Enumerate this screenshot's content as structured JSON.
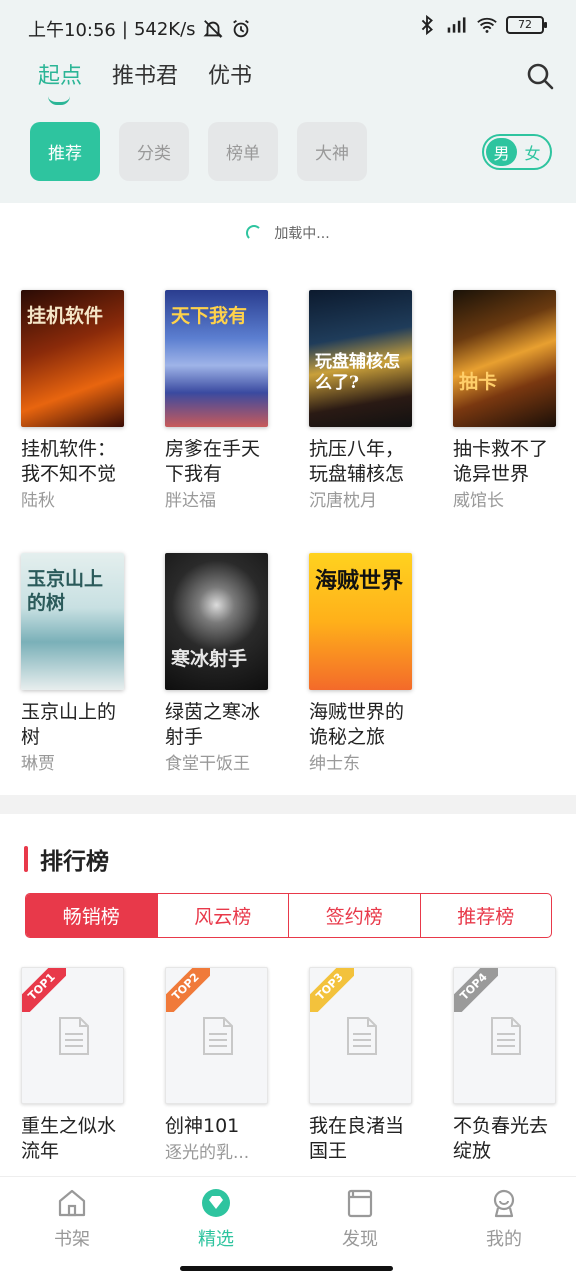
{
  "status_bar": {
    "time": "上午10:56",
    "separator": "|",
    "net_speed": "542K/s",
    "battery": "72",
    "icons": [
      "mute-bell-icon",
      "alarm-icon",
      "bluetooth-icon",
      "signal-hd-icon",
      "wifi-icon",
      "battery-icon"
    ]
  },
  "top_tabs": [
    {
      "label": "起点",
      "active": true
    },
    {
      "label": "推书君",
      "active": false
    },
    {
      "label": "优书",
      "active": false
    }
  ],
  "chips": [
    {
      "label": "推荐",
      "active": true
    },
    {
      "label": "分类",
      "active": false
    },
    {
      "label": "榜单",
      "active": false
    },
    {
      "label": "大神",
      "active": false
    }
  ],
  "gender": {
    "male": "男",
    "female": "女",
    "selected": "男"
  },
  "loading_text": "加载中...",
  "books": [
    {
      "title": "挂机软件：我不知不觉",
      "author": "陆秋",
      "cover_text": "挂机软件"
    },
    {
      "title": "房爹在手天下我有",
      "author": "胖达福",
      "cover_text": "天下我有"
    },
    {
      "title": "抗压八年，玩盘辅核怎",
      "author": "沉唐枕月",
      "cover_text": "玩盘辅核怎么了?"
    },
    {
      "title": "抽卡救不了诡异世界",
      "author": "威馆长",
      "cover_text": "抽卡"
    },
    {
      "title": "玉京山上的树",
      "author": "琳贾",
      "cover_text": "玉京山上的树"
    },
    {
      "title": "绿茵之寒冰射手",
      "author": "食堂干饭王",
      "cover_text": "寒冰射手"
    },
    {
      "title": "海贼世界的诡秘之旅",
      "author": "绅士东",
      "cover_text": "海贼世界"
    }
  ],
  "ranking": {
    "title": "排行榜",
    "tabs": [
      {
        "label": "畅销榜",
        "active": true
      },
      {
        "label": "风云榜",
        "active": false
      },
      {
        "label": "签约榜",
        "active": false
      },
      {
        "label": "推荐榜",
        "active": false
      }
    ],
    "items": [
      {
        "badge": "TOP1",
        "title": "重生之似水流年",
        "author": "",
        "color": "#e8394a"
      },
      {
        "badge": "TOP2",
        "title": "创神101",
        "author": "逐光的乳...",
        "color": "#f07a3a"
      },
      {
        "badge": "TOP3",
        "title": "我在良渚当国王",
        "author": "",
        "color": "#f3c23c"
      },
      {
        "badge": "TOP4",
        "title": "不负春光去绽放",
        "author": "",
        "color": "#9a9a9a"
      }
    ]
  },
  "bottom_nav": [
    {
      "label": "书架",
      "icon": "bookshelf-icon",
      "active": false
    },
    {
      "label": "精选",
      "icon": "featured-diamond-icon",
      "active": true
    },
    {
      "label": "发现",
      "icon": "discover-book-icon",
      "active": false
    },
    {
      "label": "我的",
      "icon": "profile-icon",
      "active": false
    }
  ],
  "colors": {
    "accent": "#2ec49f",
    "rank_red": "#e8394a"
  }
}
